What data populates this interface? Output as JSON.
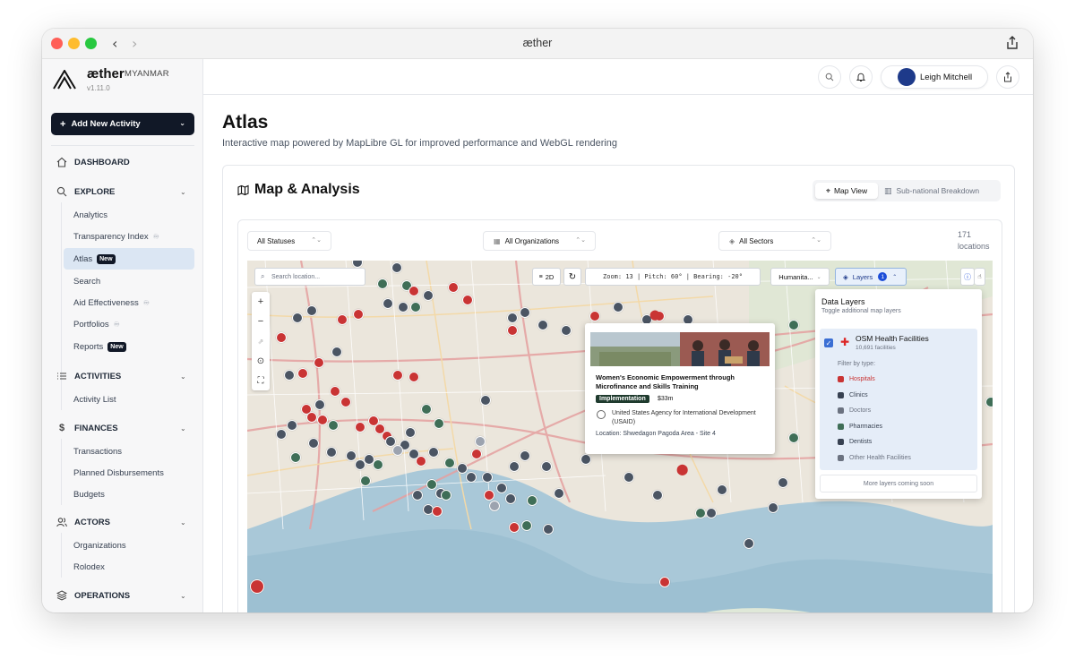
{
  "window": {
    "title": "æther"
  },
  "sidebar": {
    "brand": "æther",
    "brand_sub": "MYANMAR",
    "version": "v1.11.0",
    "add_button": "Add New Activity",
    "dashboard": "DASHBOARD",
    "explore": {
      "label": "EXPLORE",
      "items": [
        "Analytics",
        "Transparency Index",
        "Atlas",
        "Search",
        "Aid Effectiveness",
        "Portfolios",
        "Reports"
      ]
    },
    "new_badge": "New",
    "activities": {
      "label": "ACTIVITIES",
      "items": [
        "Activity List"
      ]
    },
    "finances": {
      "label": "FINANCES",
      "items": [
        "Transactions",
        "Planned Disbursements",
        "Budgets"
      ]
    },
    "actors": {
      "label": "ACTORS",
      "items": [
        "Organizations",
        "Rolodex"
      ]
    },
    "operations": {
      "label": "OPERATIONS"
    }
  },
  "topbar": {
    "user_name": "Leigh Mitchell"
  },
  "page": {
    "title": "Atlas",
    "subtitle": "Interactive map powered by MapLibre GL for improved performance and WebGL rendering"
  },
  "card": {
    "title": "Map & Analysis",
    "view_active": "Map View",
    "view_other": "Sub-national Breakdown"
  },
  "filters": {
    "status": "All Statuses",
    "organizations": "All Organizations",
    "sectors": "All Sectors",
    "count": "171",
    "count_label": "locations"
  },
  "map": {
    "search_placeholder": "Search location...",
    "mode": "2D",
    "readout": "Zoom: 13  |  Pitch: 60°  |  Bearing: -20°",
    "style": "Humanita...",
    "layers_label": "Layers",
    "layers_count": "1",
    "colors": {
      "grey": "#4b5563",
      "green": "#3f6e57",
      "red": "#c93434"
    }
  },
  "popup": {
    "title": "Women's Economic Empowerment through Microfinance and Skills Training",
    "status": "Implementation",
    "amount": "$33m",
    "org": "United States Agency for International Development (USAID)",
    "location": "Location: Shwedagon Pagoda Area - Site 4"
  },
  "layers_panel": {
    "title": "Data Layers",
    "subtitle": "Toggle additional map layers",
    "layer_name": "OSM Health Facilities",
    "layer_count": "10,691 facilities",
    "filter_label": "Filter by type:",
    "types": [
      {
        "label": "Hospitals",
        "color": "#c93434"
      },
      {
        "label": "Clinics",
        "color": "#374151"
      },
      {
        "label": "Doctors",
        "color": "#6b7280"
      },
      {
        "label": "Pharmacies",
        "color": "#3f6e57"
      },
      {
        "label": "Dentists",
        "color": "#374151"
      },
      {
        "label": "Other Health Facilities",
        "color": "#6b7280"
      }
    ],
    "more": "More layers coming soon"
  }
}
